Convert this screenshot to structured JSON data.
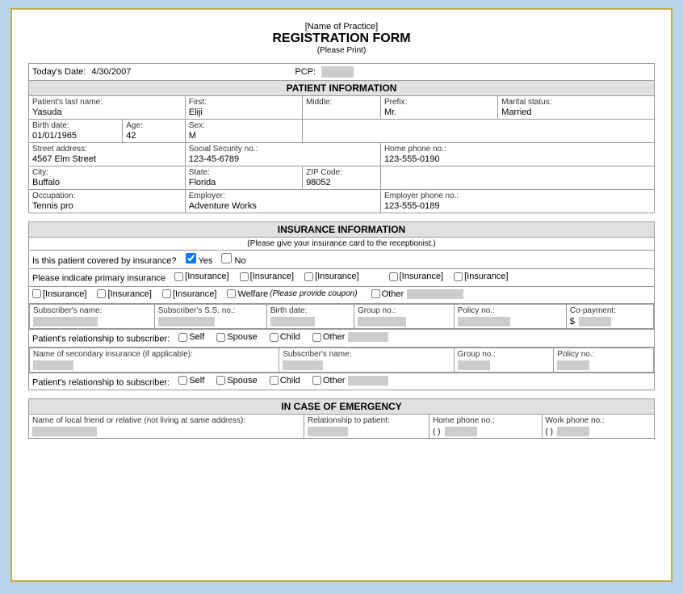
{
  "header": {
    "practice_name": "[Name of Practice]",
    "form_title": "REGISTRATION FORM",
    "please_print": "(Please Print)"
  },
  "top_bar": {
    "date_label": "Today's Date:",
    "date_value": "4/30/2007",
    "pcp_label": "PCP:"
  },
  "patient_info": {
    "section_title": "PATIENT INFORMATION",
    "last_name_label": "Patient's last name:",
    "last_name_value": "Yasuda",
    "first_label": "First:",
    "first_value": "Eliji",
    "middle_label": "Middle:",
    "prefix_label": "Prefix:",
    "prefix_value": "Mr.",
    "marital_label": "Marital status:",
    "marital_value": "Married",
    "birth_label": "Birth date:",
    "birth_value": "01/01/1965",
    "age_label": "Age:",
    "age_value": "42",
    "sex_label": "Sex:",
    "sex_value": "M",
    "street_label": "Street address:",
    "street_value": "4567 Elm Street",
    "ssn_label": "Social Security no.:",
    "ssn_value": "123-45-6789",
    "home_phone_label": "Home phone no.:",
    "home_phone_value": "123-555-0190",
    "city_label": "City:",
    "city_value": "Buffalo",
    "state_label": "State:",
    "state_value": "Florida",
    "zip_label": "ZIP Code:",
    "zip_value": "98052",
    "occupation_label": "Occupation:",
    "occupation_value": "Tennis pro",
    "employer_label": "Employer:",
    "employer_value": "Adventure Works",
    "employer_phone_label": "Employer phone no.:",
    "employer_phone_value": "123-555-0189"
  },
  "insurance_info": {
    "section_title": "INSURANCE INFORMATION",
    "section_subtitle": "(Please give your insurance card to the receptionist.)",
    "covered_label": "Is this patient covered by insurance?",
    "yes_label": "Yes",
    "no_label": "No",
    "primary_label": "Please indicate primary insurance",
    "insurance_options": [
      "[Insurance]",
      "[Insurance]",
      "[Insurance]",
      "[Insurance]",
      "[Insurance]",
      "[Insurance]",
      "[Insurance]",
      "[Insurance]"
    ],
    "welfare_label": "Welfare",
    "welfare_sub": "(Please provide coupon)",
    "other_label": "Other",
    "subscriber_name_label": "Subscriber's name:",
    "subscriber_ss_label": "Subscriber's S.S. no.:",
    "birth_date_label": "Birth date:",
    "group_no_label": "Group no.:",
    "policy_no_label": "Policy no.:",
    "copayment_label": "Co-payment:",
    "copayment_prefix": "$",
    "relationship_label": "Patient's relationship to subscriber:",
    "self_label": "Self",
    "spouse_label": "Spouse",
    "child_label": "Child",
    "other_rel_label": "Other",
    "secondary_label": "Name of secondary insurance (if applicable):",
    "secondary_subscriber_label": "Subscriber's name:",
    "secondary_group_label": "Group no.:",
    "secondary_policy_label": "Policy no.:",
    "secondary_relationship_label": "Patient's relationship to subscriber:",
    "secondary_self_label": "Self",
    "secondary_spouse_label": "Spouse",
    "secondary_child_label": "Child",
    "secondary_other_label": "Other"
  },
  "emergency": {
    "section_title": "IN CASE OF EMERGENCY",
    "name_label": "Name of local friend or relative (not living at same address):",
    "relationship_label": "Relationship to patient:",
    "home_phone_label": "Home phone no.:",
    "home_phone_format": "( )",
    "work_phone_label": "Work phone no.:",
    "work_phone_format": "( )"
  }
}
